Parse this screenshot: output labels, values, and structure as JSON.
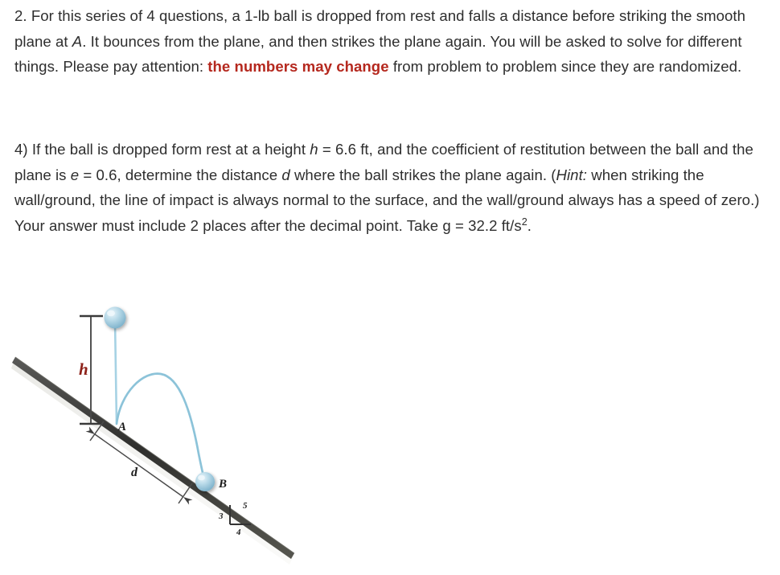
{
  "problem": {
    "intro": {
      "number": "2.",
      "text_before_emphasis": "For this series of 4 questions, a 1-lb ball is dropped from rest and falls a distance before striking the smooth plane at ",
      "point_a": "A",
      "text_middle": ". It bounces from the plane, and then strikes the plane again. You will be asked to solve for different things. Please pay attention: ",
      "emphasis": "the numbers may change",
      "text_after_emphasis": " from problem to problem since they are randomized."
    },
    "question": {
      "number": "4)",
      "seg_1": "If the ball is dropped form rest at a height ",
      "var_h": "h",
      "seg_2": " = 6.6 ft, and the coefficient of restitution between the ball and the plane is ",
      "var_e": "e",
      "seg_3": " = 0.6, determine the distance ",
      "var_d": "d",
      "seg_4": " where the ball strikes the plane again. (",
      "hint_word": "Hint:",
      "seg_5": " when striking the wall/ground, the line of impact is always normal to the surface, and the wall/ground always has a speed of zero.) Your answer must include 2 places after the decimal point. Take g = 32.2 ft/s",
      "exponent": "2",
      "seg_6": "."
    },
    "values": {
      "height_h": "6.6 ft",
      "restitution_e": "0.6",
      "gravity_g": "32.2 ft/s^2",
      "ball_weight": "1-lb",
      "decimal_places": "2"
    }
  },
  "figure": {
    "label_h": "h",
    "label_a": "A",
    "label_b": "B",
    "label_d": "d",
    "slope_triangle": {
      "vertical": "3",
      "horizontal": "4",
      "hypotenuse": "5"
    },
    "colors": {
      "ball_fill": "#a9cfe0",
      "trajectory": "#8cc3d9",
      "incline": "#3b3b3b",
      "dimension": "#4a4a4a",
      "h_label": "#8d2119"
    }
  }
}
